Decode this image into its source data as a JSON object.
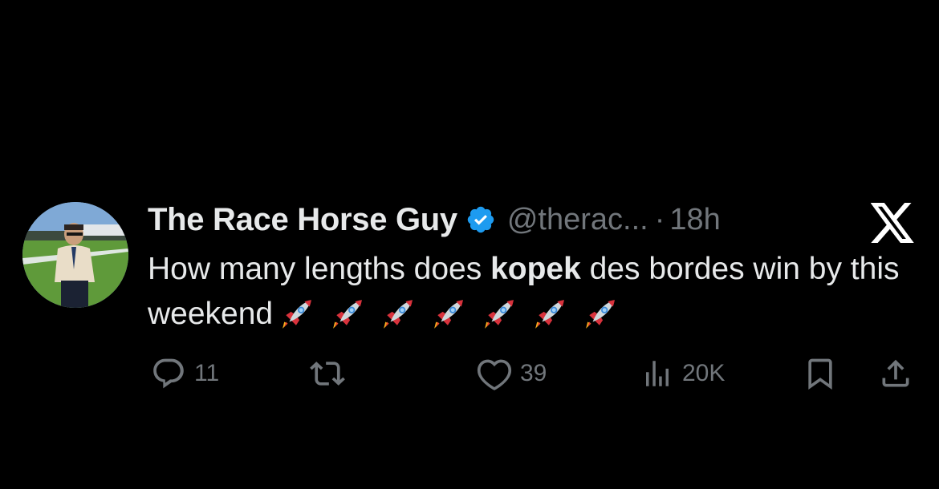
{
  "tweet": {
    "author": {
      "display_name": "The Race Horse Guy",
      "handle": "@therac...",
      "verified": true
    },
    "separator": "·",
    "timestamp": "18h",
    "text": {
      "part1": "How many lengths does ",
      "bold": "kopek",
      "part2": " des bordes win by this weekend",
      "emoji": [
        "🚀",
        "🚀",
        "🚀",
        "🚀",
        "🚀",
        "🚀",
        "🚀"
      ]
    },
    "actions": {
      "replies": "11",
      "likes": "39",
      "views": "20K"
    }
  },
  "brand": {
    "logo_icon": "x-logo-icon",
    "verified_color": "#1d9bf0"
  },
  "colors": {
    "background": "#000000",
    "primary_text": "#e7e9ea",
    "secondary_text": "#71767b"
  }
}
